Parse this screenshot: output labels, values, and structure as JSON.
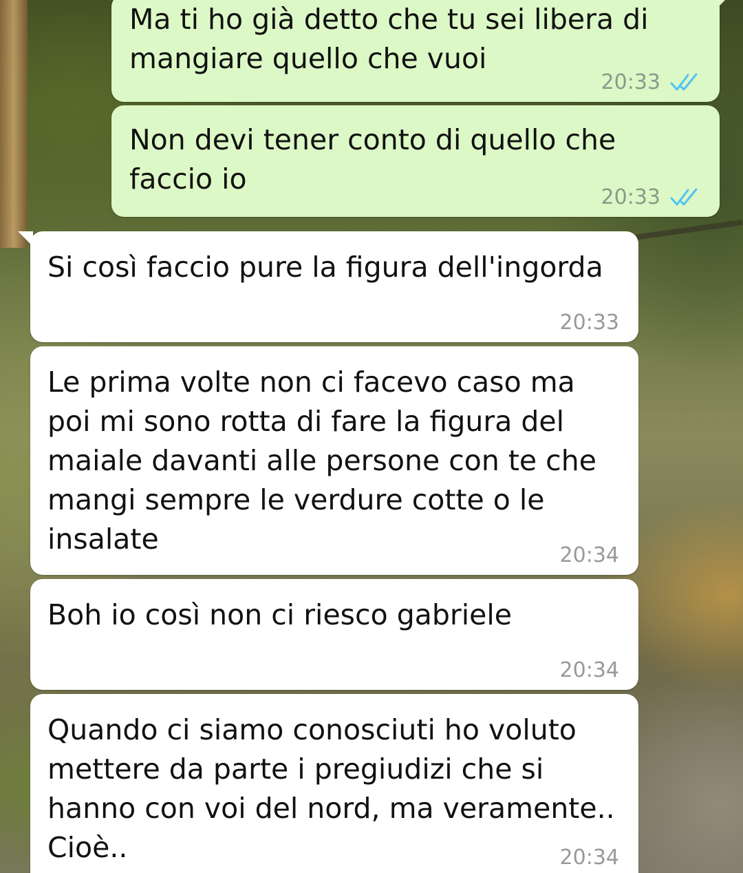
{
  "colors": {
    "outgoing_bubble": "#dcf8c6",
    "incoming_bubble": "#ffffff",
    "read_ticks": "#4fc3f7",
    "timestamp": "#999999"
  },
  "messages": [
    {
      "direction": "outgoing",
      "text": "Ma ti ho già detto che tu sei libera di mangiare quello che vuoi",
      "time": "20:33",
      "status_icon": "double-check-read-icon"
    },
    {
      "direction": "outgoing",
      "text": "Non devi tener conto di quello che faccio io",
      "time": "20:33",
      "status_icon": "double-check-read-icon"
    },
    {
      "direction": "incoming",
      "text": "Si così faccio pure la figura dell'ingorda",
      "time": "20:33"
    },
    {
      "direction": "incoming",
      "text": "Le prima volte non ci facevo caso ma poi mi sono rotta di fare la figura del maiale davanti alle persone con te che mangi sempre le verdure cotte o le insalate",
      "time": "20:34"
    },
    {
      "direction": "incoming",
      "text": "Boh io così non ci riesco gabriele",
      "time": "20:34"
    },
    {
      "direction": "incoming",
      "text": "Quando ci siamo conosciuti ho voluto mettere da parte i pregiudizi che si hanno con voi del nord, ma veramente.. Cioè..",
      "time": "20:34"
    }
  ]
}
